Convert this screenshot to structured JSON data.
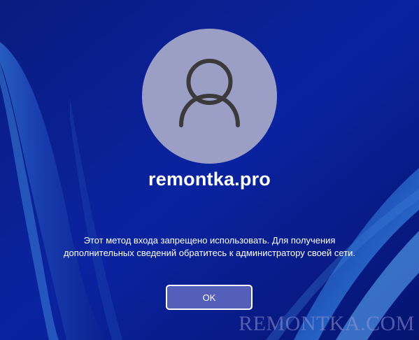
{
  "screen": {
    "type": "windows-logon-error",
    "background_colors": {
      "base": "#061a7a",
      "accent": "#3a7fd8"
    }
  },
  "user": {
    "avatar_icon": "person-icon",
    "name": "remontka.pro"
  },
  "message": {
    "line1": "Этот метод входа запрещено использовать. Для получения",
    "line2": "дополнительных сведений обратитесь к администратору своей сети."
  },
  "button": {
    "ok_label": "OK"
  },
  "watermark": {
    "text": "REMONTKA.COM"
  }
}
